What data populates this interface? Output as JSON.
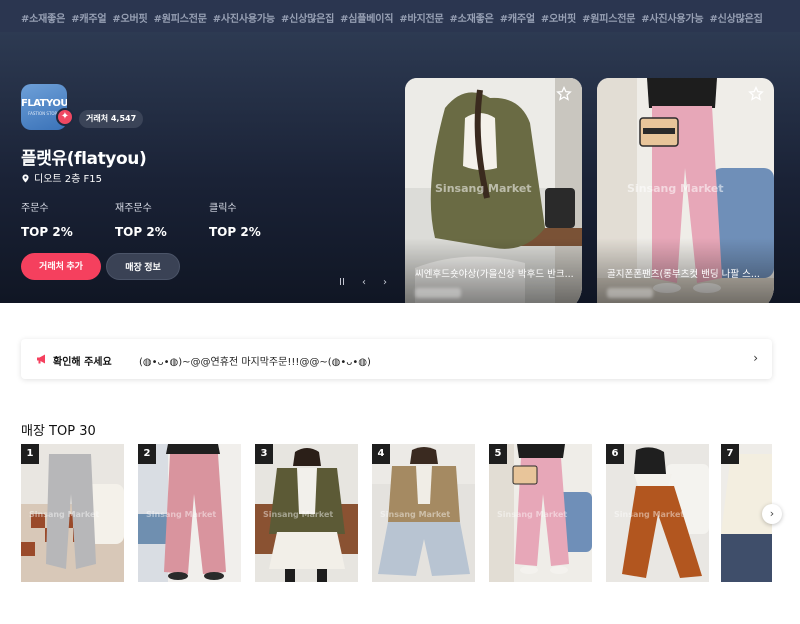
{
  "tags": [
    "#소재좋은",
    "#캐주얼",
    "#오버핏",
    "#원피스전문",
    "#사진사용가능",
    "#신상많은집",
    "#심플베이직",
    "#바지전문",
    "#소재좋은",
    "#캐주얼",
    "#오버핏",
    "#원피스전문",
    "#사진사용가능",
    "#신상많은집"
  ],
  "store": {
    "logo_text": "FLATYOU",
    "logo_sub": "FASTION STORE",
    "deal_count": "거래처 4,547",
    "name": "플랫유(flatyou)",
    "location": "디오트 2층 F15"
  },
  "stats": [
    {
      "label": "주문수",
      "value": "TOP 2%"
    },
    {
      "label": "재주문수",
      "value": "TOP 2%"
    },
    {
      "label": "클릭수",
      "value": "TOP 2%"
    }
  ],
  "buttons": {
    "add": "거래처 추가",
    "info": "매장 정보"
  },
  "controls": {
    "pause": "II",
    "prev": "‹",
    "next": "›"
  },
  "featured": [
    {
      "title": "씨엔후드숏야상(가을신상 박후드 반크...",
      "watermark": "Sinsang Market"
    },
    {
      "title": "골지폰폰팬츠(롱부츠컷 밴딩 나팔 스...",
      "watermark": "Sinsang Market"
    }
  ],
  "notice": {
    "label": "확인해 주세요",
    "text": "(◍•ᴗ•◍)~@@연휴전 마지막주문!!!@@~(◍•ᴗ•◍)"
  },
  "top30": {
    "title": "매장 TOP 30",
    "ranks": [
      "1",
      "2",
      "3",
      "4",
      "5",
      "6",
      "7"
    ],
    "watermark": "Sinsang Market"
  },
  "colors": {
    "accent": "#f5405e",
    "hero": "#1a2236"
  }
}
